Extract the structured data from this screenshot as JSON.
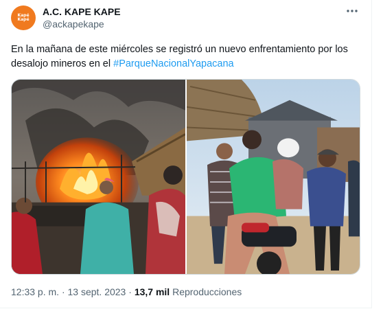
{
  "account": {
    "name": "A.C. KAPE KAPE",
    "handle": "@ackapekape",
    "avatar_color": "#f07a1f",
    "avatar_text": "Kapé Kapé"
  },
  "tweet": {
    "text_before_hashtag": "En la mañana de este miércoles se registró un nuevo enfrentamiento por los desalojo mineros en el ",
    "hashtag": "#ParqueNacionalYapacana",
    "hashtag_color": "#1d9bf0"
  },
  "media": {
    "left_image": "photo of a burning wooden hut with onlookers",
    "right_image": "photo of an injured man being carried on a motorcycle"
  },
  "footer": {
    "time": "12:33 p. m.",
    "separator": "·",
    "date": "13 sept. 2023",
    "views_count": "13,7 mil",
    "views_label": "Reproducciones"
  },
  "icons": {
    "more": "more-options-icon"
  }
}
